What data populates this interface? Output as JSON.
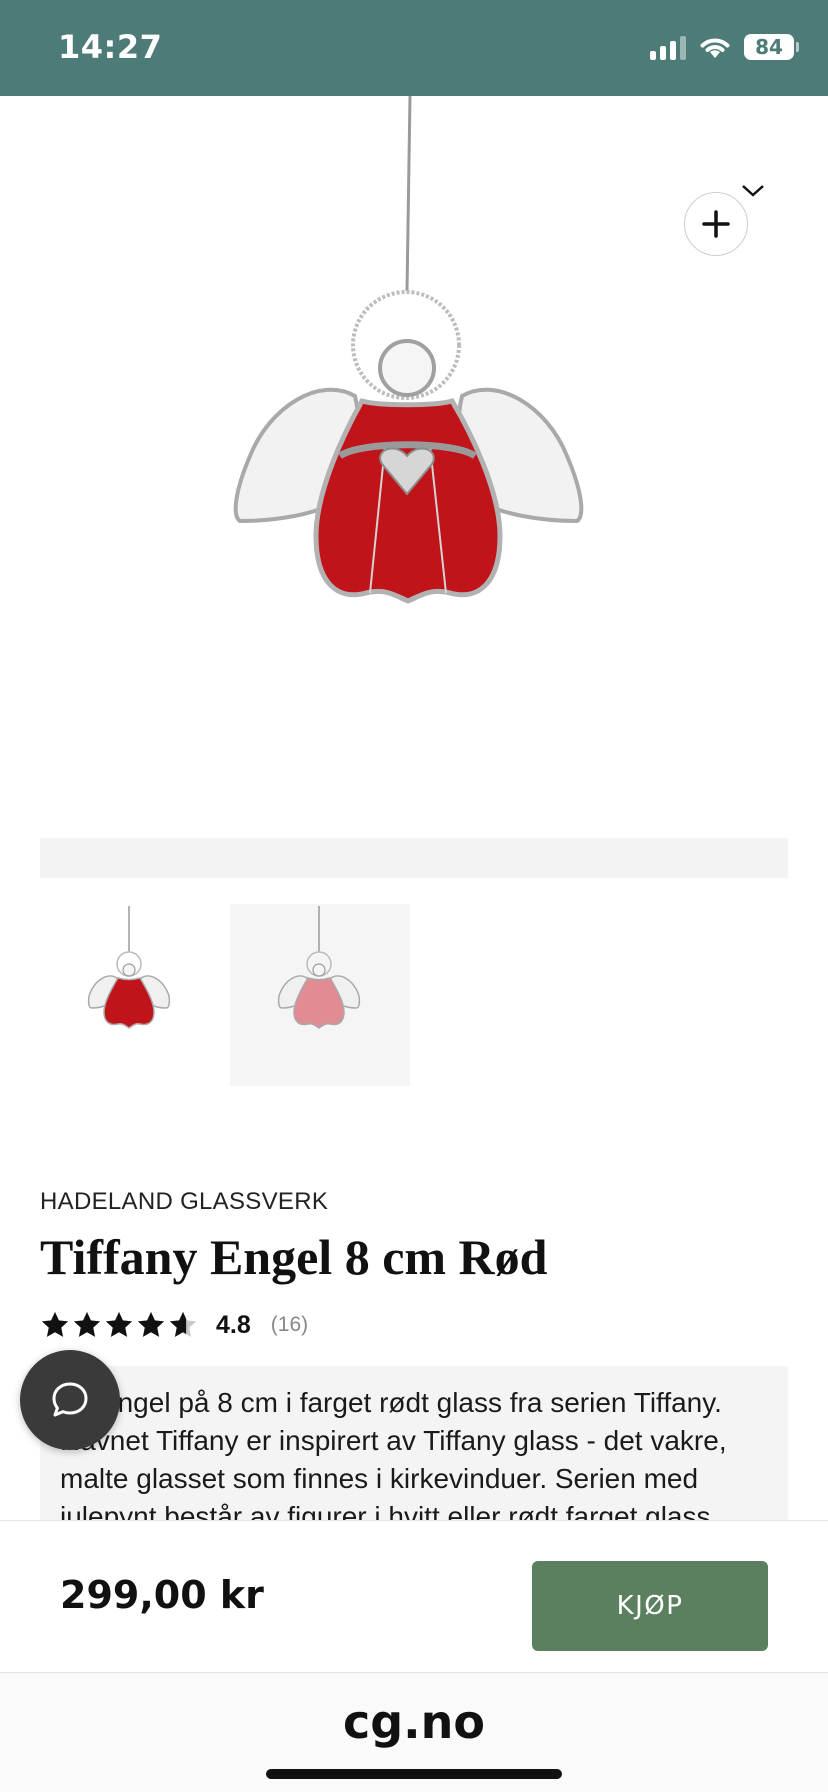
{
  "status_bar": {
    "time": "14:27",
    "battery": "84",
    "icons": [
      "cellular-signal-icon",
      "wifi-icon",
      "battery-icon"
    ]
  },
  "product": {
    "image_alt": "Tiffany Engel 8 cm Rød",
    "brand": "HADELAND GLASSVERK",
    "title": "Tiffany Engel 8 cm Rød",
    "rating": {
      "stars": 4.8,
      "max": 5,
      "value": "4.8",
      "count": "(16)"
    },
    "description": "En engel på 8 cm i farget rødt glass fra serien Tiffany. Navnet Tiffany er inspirert av Tiffany glass - det vakre, malte glasset som finnes i kirkevinduer. Serien med julepynt består av figurer i hvitt eller rødt farget glass.",
    "thumbnails": [
      {
        "name": "red-angel",
        "color": "#c0131a"
      },
      {
        "name": "pink-angel",
        "color": "#e08c92"
      }
    ]
  },
  "buy_bar": {
    "price": "299,00 kr",
    "buy_label": "KJØP"
  },
  "browser": {
    "url": "cg.no"
  },
  "colors": {
    "status_bar": "#4d7b78",
    "buy_button": "#5a8060",
    "angel_red": "#c0131a",
    "angel_pink": "#e08c92"
  }
}
